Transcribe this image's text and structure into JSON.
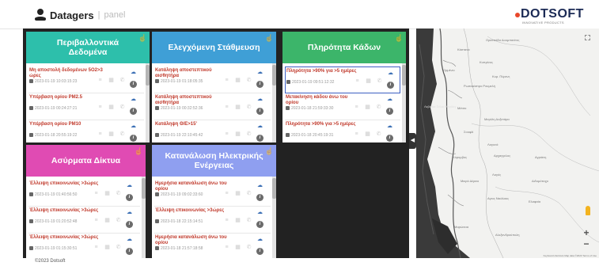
{
  "header": {
    "app_name": "Datagers",
    "separator": "|",
    "subtitle": "panel"
  },
  "dotsoft": {
    "word": "DOTSOFT",
    "tagline": "INNOVATIVE PRODUCTS",
    "dot_color": "#e8472b"
  },
  "cards": [
    {
      "title": "Περιβαλλοντικά Δεδομένα",
      "color": "#2dbfab",
      "items": [
        {
          "title": "Μη αποστολή δεδομένων 5Ο2>3 ώρες",
          "date": "2023-01-19 10:03:15:23"
        },
        {
          "title": "Υπέρβαση ορίου PM2.5",
          "date": "2023-01-19 00:24:27:21"
        },
        {
          "title": "Υπέρβαση ορίου PM10",
          "date": "2023-01-18 20:55:19:22"
        }
      ]
    },
    {
      "title": "Ελεγχόμενη Στάθμευση",
      "color": "#3f9fd6",
      "items": [
        {
          "title": "Κατάληψη αποστεπτικού αισθητήρα",
          "date": "2023-01-19 01:18:05:35"
        },
        {
          "title": "Κατάληψη αποστεπτικού αισθητήρα",
          "date": "2023-01-19 00:32:52:36"
        },
        {
          "title": "Κατάληψη Θ/Ε>15'",
          "date": "2023-01-19 22:10:45:42"
        }
      ]
    },
    {
      "title": "Πληρότητα Κάδων",
      "color": "#3cb56a",
      "items": [
        {
          "title": "Πληρότητα >90% για >5 ημέρες",
          "date": "2023-01-19 09:51:12:32"
        },
        {
          "title": "Μετακίνηση κάδου άνω του ορίου",
          "date": "2023-01-18 21:59:33:30"
        },
        {
          "title": "Πληρότητα >90% για >5 ημέρες",
          "date": "2023-01-18 20:45:19:31"
        }
      ]
    },
    {
      "title": "Ασύρματα Δίκτυα",
      "color": "#e04bb3",
      "items": [
        {
          "title": "Έλλειψη επικοινωνίας >3ώρες",
          "date": "2023-01-19 01:40:56:50"
        },
        {
          "title": "Έλλειψη επικοινωνίας >3ώρες",
          "date": "2023-01-19 01:20:52:48"
        },
        {
          "title": "Έλλειψη επικοινωνίας >3ώρες",
          "date": "2023-01-19 01:15:30:51"
        }
      ]
    },
    {
      "title": "Κατανάλωση Ηλεκτρικής Ενέργειας",
      "color": "#8f9ff0",
      "items": [
        {
          "title": "Ημερήσια κατανάλωση άνω του ορίου",
          "date": "2023-01-19 09:02:33:60"
        },
        {
          "title": "Έλλειψη επικοινωνίας >3ώρες",
          "date": "2023-01-18 22:15:14:51"
        },
        {
          "title": "Ημερήσια κατανάλωση άνω του ορίου",
          "date": "2023-01-18 21:57:18:58"
        }
      ]
    }
  ],
  "icons": {
    "hand": "☝",
    "calendar": "▦",
    "list": "≡",
    "phone": "✆",
    "wifi": "☁",
    "info": "i",
    "toggle": "◀",
    "zoom_in": "+",
    "zoom_out": "−"
  },
  "map": {
    "labels": [
      "Ορεστιάδα Δουμπανίτες",
      "Κάστανα",
      "Ορμένιο",
      "Κυπρίνος",
      "Ρωσοκάστρο Ρουμελή",
      "Κυρ. Πύρενς",
      "Λεβαδια Σέλιο Μεγάλη",
      "Μέτσο",
      "Σουφλί",
      "Μεγάλη Δοξιπάρα",
      "Λαγυνά",
      "Κόρυμβος",
      "Αρχαγγελος",
      "Αγριάνη",
      "Μικρό Δέρειο",
      "Λαγός",
      "Διδυμότειχο",
      "Αγιος Νικόλαος",
      "Ελαφαία",
      "Μαρώνεια",
      "Αλεξανδρούπολη"
    ],
    "attribution": "Keyboard shortcuts   Map data ©2023   Terms of Use"
  },
  "footer": {
    "copyright": "©2023 Dotsoft"
  }
}
